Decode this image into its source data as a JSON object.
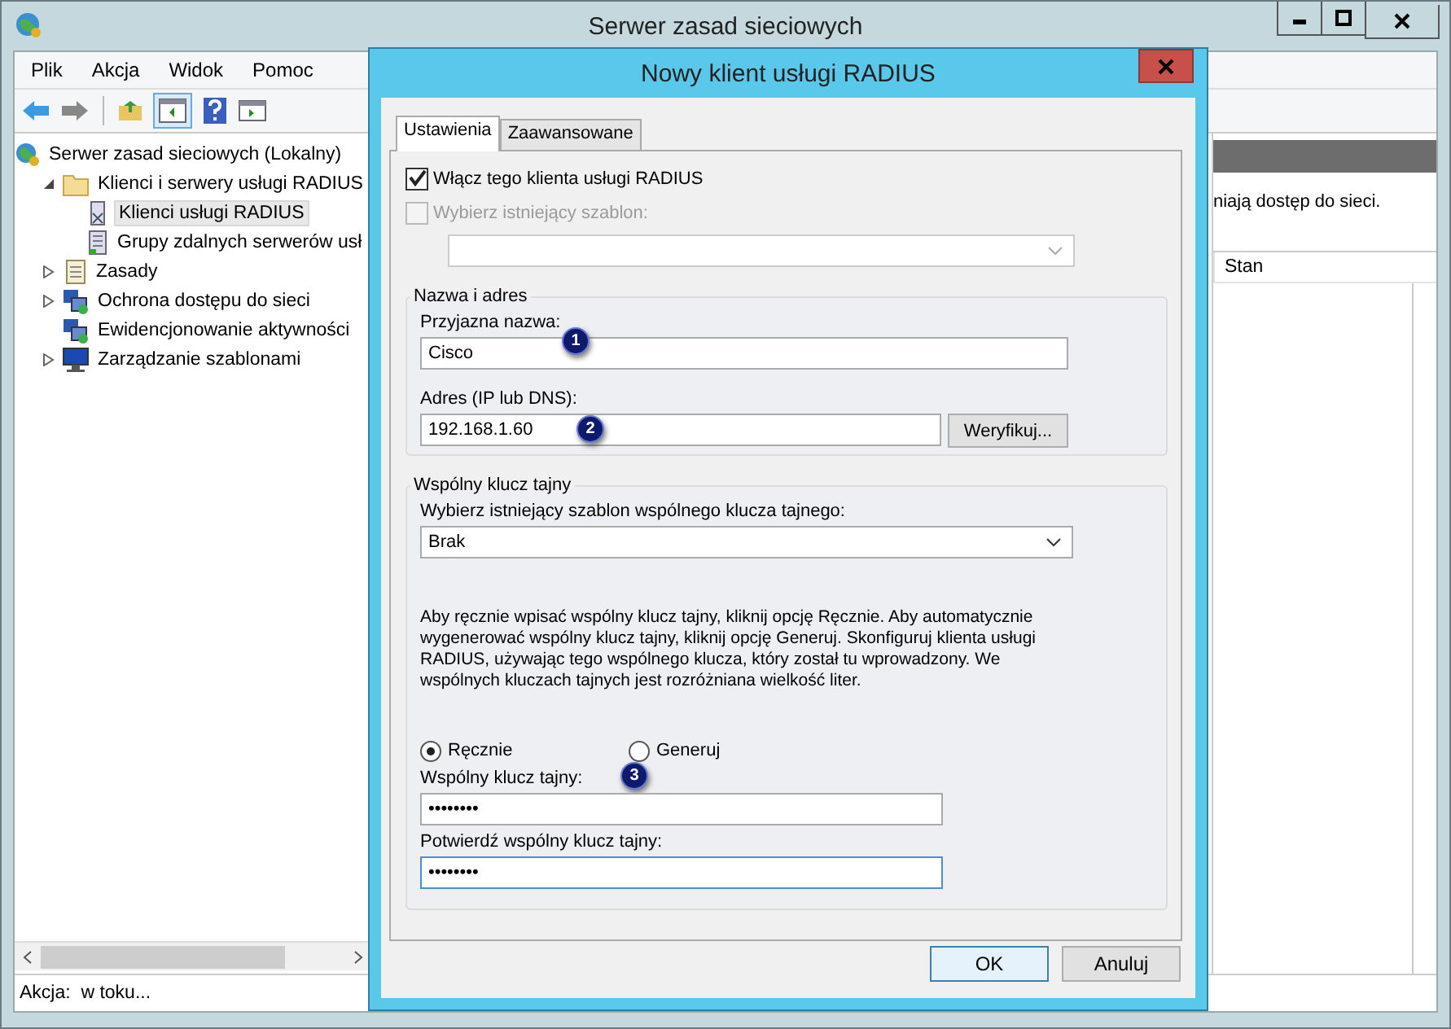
{
  "window": {
    "title": "Serwer zasad sieciowych"
  },
  "menu": [
    "Plik",
    "Akcja",
    "Widok",
    "Pomoc"
  ],
  "tree": [
    {
      "label": "Serwer zasad sieciowych (Lokalny)",
      "kind": "globe",
      "selected": false,
      "children": [
        {
          "label": "Klienci i serwery usługi RADIUS",
          "kind": "folder",
          "expanded": true,
          "selected": false,
          "children": [
            {
              "label": "Klienci usługi RADIUS",
              "kind": "client",
              "selected": true
            },
            {
              "label": "Grupy zdalnych serwerów usł",
              "kind": "server",
              "selected": false
            }
          ]
        },
        {
          "label": "Zasady",
          "kind": "scroll",
          "expanded": false,
          "selected": false
        },
        {
          "label": "Ochrona dostępu do sieci",
          "kind": "network",
          "expanded": false,
          "selected": false
        },
        {
          "label": "Ewidencjonowanie aktywności",
          "kind": "network",
          "selected": false
        },
        {
          "label": "Zarządzanie szablonami",
          "kind": "monitor",
          "expanded": false,
          "selected": false
        }
      ]
    }
  ],
  "right_pane": {
    "description": "niają dostęp do sieci.",
    "columns": [
      "Stan"
    ]
  },
  "status_bar": "Akcja:  w toku...",
  "dialog": {
    "title": "Nowy klient usługi RADIUS",
    "tabs": [
      {
        "label": "Ustawienia",
        "selected": true
      },
      {
        "label": "Zaawansowane",
        "selected": false
      }
    ],
    "enable": {
      "label": "Włącz tego klienta usługi RADIUS",
      "checked": true,
      "disabled": false
    },
    "use_template": {
      "label": "Wybierz istniejący szablon:",
      "checked": false,
      "disabled": true
    },
    "name_group": {
      "title": "Nazwa i adres",
      "name_label": "Przyjazna nazwa:",
      "name_value": "Cisco",
      "address_label": "Adres (IP lub DNS):",
      "address_value": "192.168.1.60",
      "verify_button": "Weryfikuj..."
    },
    "secret_group": {
      "title": "Wspólny klucz tajny",
      "template_label": "Wybierz istniejący szablon wspólnego klucza tajnego:",
      "template_value": "Brak",
      "info": "Aby ręcznie wpisać wspólny klucz tajny, kliknij opcję Ręcznie. Aby automatycznie wygenerować wspólny klucz tajny, kliknij opcję Generuj. Skonfiguruj klienta usługi RADIUS, używając tego wspólnego klucza, który został tu wprowadzony. We wspólnych kluczach tajnych jest rozróżniana wielkość liter.",
      "modes": [
        {
          "label": "Ręcznie",
          "selected": true
        },
        {
          "label": "Generuj",
          "selected": false
        }
      ],
      "secret_label": "Wspólny klucz tajny:",
      "secret_value": "••••••••",
      "confirm_label": "Potwierdź wspólny klucz tajny:",
      "confirm_value": "••••••••"
    },
    "buttons": [
      "OK",
      "Anuluj"
    ],
    "callouts": [
      "1",
      "2",
      "3"
    ]
  }
}
